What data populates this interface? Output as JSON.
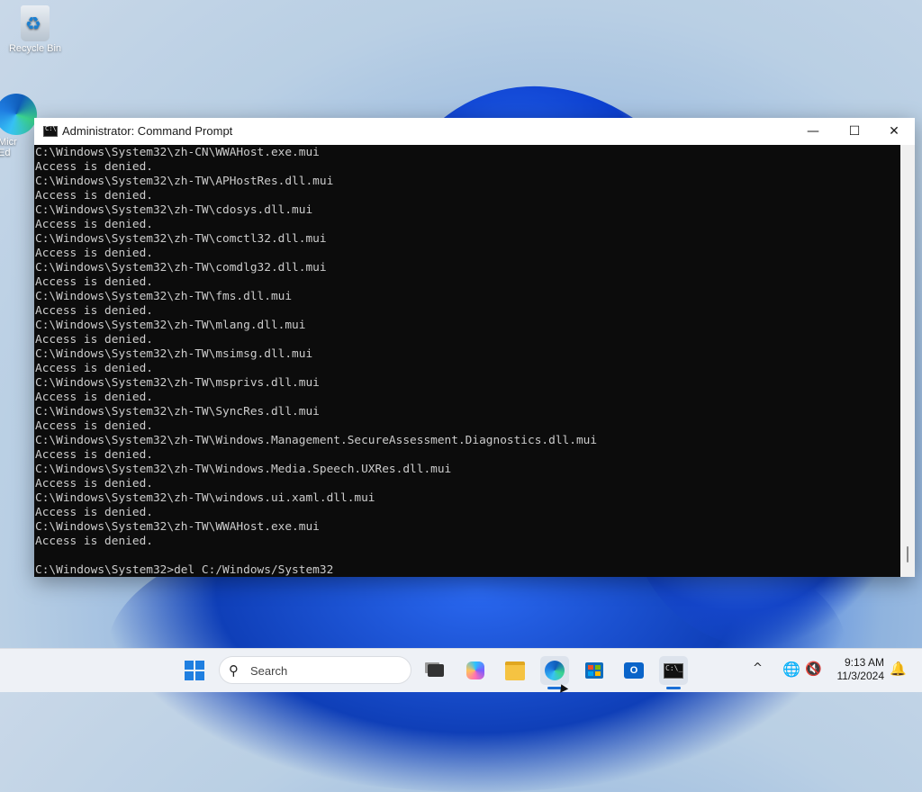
{
  "desktop": {
    "icons": [
      {
        "label": "Recycle Bin"
      },
      {
        "label": "Micr\nEd"
      }
    ]
  },
  "window": {
    "title": "Administrator: Command Prompt",
    "controls": {
      "minimize": "—",
      "maximize": "☐",
      "close": "✕"
    },
    "console_lines": [
      "C:\\Windows\\System32\\zh-CN\\WWAHost.exe.mui",
      "Access is denied.",
      "C:\\Windows\\System32\\zh-TW\\APHostRes.dll.mui",
      "Access is denied.",
      "C:\\Windows\\System32\\zh-TW\\cdosys.dll.mui",
      "Access is denied.",
      "C:\\Windows\\System32\\zh-TW\\comctl32.dll.mui",
      "Access is denied.",
      "C:\\Windows\\System32\\zh-TW\\comdlg32.dll.mui",
      "Access is denied.",
      "C:\\Windows\\System32\\zh-TW\\fms.dll.mui",
      "Access is denied.",
      "C:\\Windows\\System32\\zh-TW\\mlang.dll.mui",
      "Access is denied.",
      "C:\\Windows\\System32\\zh-TW\\msimsg.dll.mui",
      "Access is denied.",
      "C:\\Windows\\System32\\zh-TW\\msprivs.dll.mui",
      "Access is denied.",
      "C:\\Windows\\System32\\zh-TW\\SyncRes.dll.mui",
      "Access is denied.",
      "C:\\Windows\\System32\\zh-TW\\Windows.Management.SecureAssessment.Diagnostics.dll.mui",
      "Access is denied.",
      "C:\\Windows\\System32\\zh-TW\\Windows.Media.Speech.UXRes.dll.mui",
      "Access is denied.",
      "C:\\Windows\\System32\\zh-TW\\windows.ui.xaml.dll.mui",
      "Access is denied.",
      "C:\\Windows\\System32\\zh-TW\\WWAHost.exe.mui",
      "Access is denied.",
      "",
      "C:\\Windows\\System32>del C:/Windows/System32"
    ]
  },
  "taskbar": {
    "search_placeholder": "Search",
    "apps": [
      {
        "icon": "start-windows-icon"
      },
      {
        "icon": "task-view-icon"
      },
      {
        "icon": "copilot-icon"
      },
      {
        "icon": "file-explorer-icon"
      },
      {
        "icon": "edge-icon"
      },
      {
        "icon": "store-icon"
      },
      {
        "icon": "outlook-icon"
      },
      {
        "icon": "terminal-icon"
      }
    ],
    "tray": {
      "chevron": "^",
      "time": "9:13 AM",
      "date": "11/3/2024"
    }
  },
  "colors": {
    "console_bg": "#0c0c0c",
    "console_fg": "#cccccc",
    "accent": "#1a6fd6"
  }
}
